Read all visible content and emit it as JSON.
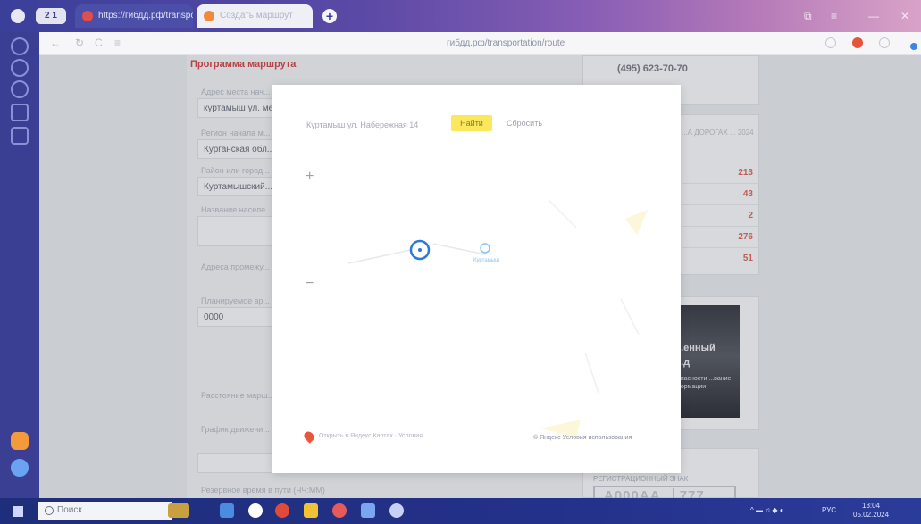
{
  "browser": {
    "tab_group_label": "2 1",
    "tabs": [
      {
        "title": "https://гибдд.рф/transport",
        "active": false
      },
      {
        "title": "Создать маршрут",
        "active": true
      }
    ],
    "new_tab": "+",
    "url": "гибдд.рф/transportation/route",
    "window_controls": [
      "⧉",
      "≡",
      "—",
      "✕"
    ]
  },
  "sidebar": {
    "icons": [
      "profile-icon",
      "bookmarks-icon",
      "history-icon",
      "downloads-icon",
      "settings-icon",
      "alice-icon",
      "messenger-icon"
    ]
  },
  "form": {
    "section_title": "Программа маршрута",
    "fields": [
      {
        "label": "Адрес места нач...",
        "value": "куртамыш ул. ме..."
      },
      {
        "label": "Регион начала м...",
        "value": "Курганская обл..."
      },
      {
        "label": "Район или город...",
        "value": "Куртамышский..."
      },
      {
        "label": "Название населе...",
        "value": ""
      },
      {
        "label": "Адреса промежу...",
        "value": ""
      },
      {
        "label": "Планируемое вр...",
        "value": "0000"
      },
      {
        "label": "Расстояние марш...",
        "value": ""
      },
      {
        "label": "График движени...",
        "value": ""
      },
      {
        "label": "Резервное время в пути (ЧЧ:ММ)",
        "value": ""
      }
    ]
  },
  "right_panel": {
    "phone": "(495) 623-70-70",
    "stats_title": "...А ДОРОГАХ ... 2024",
    "stats": [
      "213",
      "43",
      "2",
      "276",
      "51"
    ],
    "promo_title_1": "...енный",
    "promo_title_2": "...д",
    "promo_small": "...пасности ...вание ...ормации",
    "plate_label": "РЕГИСТРАЦИОННЫЙ ЗНАК",
    "plate_number": "А000АА",
    "plate_region": "777"
  },
  "map_modal": {
    "search_text": "Куртамыш ул. Набережная 14",
    "find_label": "Найти",
    "reset_label": "Сбросить",
    "zoom_in": "+",
    "zoom_out": "−",
    "marker_label": "Куртамыш",
    "footer_left": "Открыть в Яндекс.Картах · Условия",
    "footer_right": "© Яндекс Условия использования"
  },
  "taskbar": {
    "search_placeholder": "Поиск",
    "clock_time": "13:04",
    "clock_date": "05.02.2024",
    "tray_lang": "РУС"
  }
}
